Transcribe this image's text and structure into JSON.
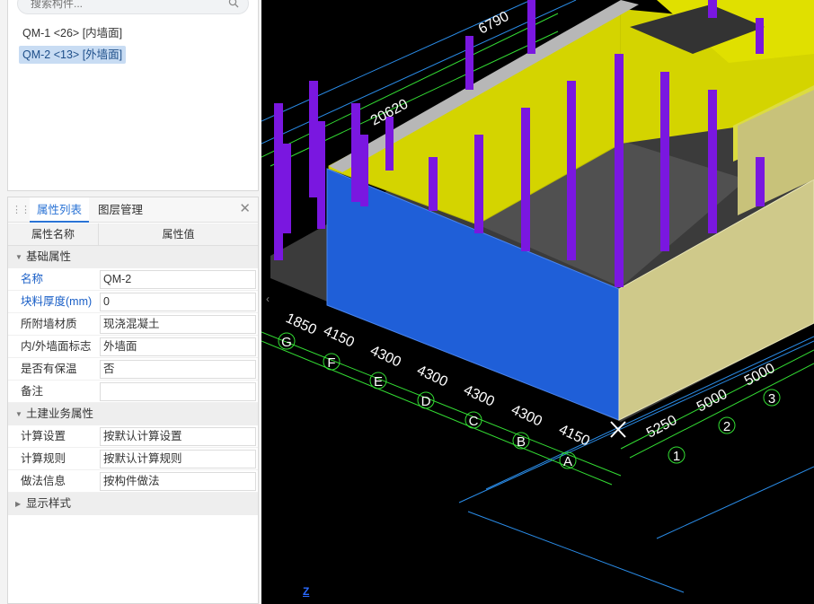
{
  "search": {
    "placeholder": "搜索构件..."
  },
  "components": [
    {
      "label": "QM-1 <26> [内墙面]",
      "selected": false
    },
    {
      "label": "QM-2 <13> [外墙面]",
      "selected": true
    }
  ],
  "tabs": [
    {
      "label": "属性列表",
      "active": true
    },
    {
      "label": "图层管理",
      "active": false
    }
  ],
  "grid": {
    "col_name": "属性名称",
    "col_value": "属性值",
    "groups": [
      {
        "title": "基础属性",
        "expanded": true,
        "rows": [
          {
            "name": "名称",
            "value": "QM-2",
            "highlight": true
          },
          {
            "name": "块料厚度(mm)",
            "value": "0",
            "highlight": true
          },
          {
            "name": "所附墙材质",
            "value": "现浇混凝土"
          },
          {
            "name": "内/外墙面标志",
            "value": "外墙面"
          },
          {
            "name": "是否有保温",
            "value": "否"
          },
          {
            "name": "备注",
            "value": ""
          }
        ]
      },
      {
        "title": "土建业务属性",
        "expanded": true,
        "rows": [
          {
            "name": "计算设置",
            "value": "按默认计算设置"
          },
          {
            "name": "计算规则",
            "value": "按默认计算规则"
          },
          {
            "name": "做法信息",
            "value": "按构件做法"
          }
        ]
      },
      {
        "title": "显示样式",
        "expanded": false,
        "rows": []
      }
    ]
  },
  "viewport": {
    "dims": [
      "6790",
      "20620",
      "1850",
      "4150",
      "4300",
      "4300",
      "4300",
      "4300",
      "4150",
      "5250",
      "5000",
      "5000"
    ],
    "axes_letters": [
      "G",
      "F",
      "E",
      "D",
      "C",
      "B",
      "A"
    ],
    "axes_numbers": [
      "1",
      "2",
      "3"
    ],
    "axis_z_label": "Z",
    "colors": {
      "wall_blue": "#1f5fd8",
      "wall_yellow": "#d4d400",
      "column": "#7a17e0",
      "grid_green": "#33dd33",
      "dim_cyan": "#45d8d8"
    }
  }
}
